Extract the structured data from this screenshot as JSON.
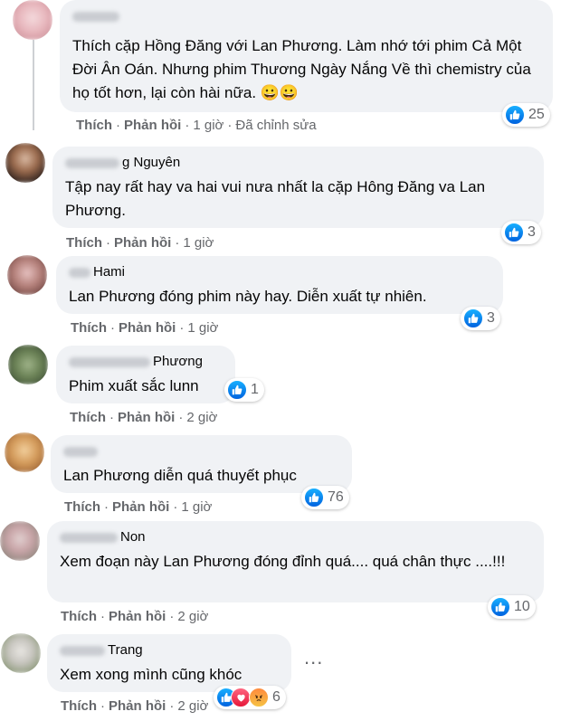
{
  "comments": [
    {
      "author_visible": "",
      "text": "Thích cặp Hồng Đăng với Lan Phương. Làm nhớ tới phim Cả Một Đời Ân Oán. Nhưng phim Thương Ngày Nắng Về thì chemistry của họ tốt hơn, lại còn hài nữa. 😀😀",
      "like": "Thích",
      "reply": "Phản hồi",
      "time": "1 giờ",
      "edited": "Đã chỉnh sửa",
      "reactions": "25"
    },
    {
      "author_visible": "g Nguyên",
      "text": "Tập nay rất hay va hai vui nưa nhất la cặp Hông Đăng va Lan Phương.",
      "like": "Thích",
      "reply": "Phản hồi",
      "time": "1 giờ",
      "reactions": "3"
    },
    {
      "author_visible": "Hami",
      "text": "Lan Phương đóng phim này hay. Diễn xuất tự nhiên.",
      "like": "Thích",
      "reply": "Phản hồi",
      "time": "1 giờ",
      "reactions": "3"
    },
    {
      "author_visible": "Phương",
      "text": "Phim xuất sắc lunn",
      "like": "Thích",
      "reply": "Phản hồi",
      "time": "2 giờ",
      "reactions": "1"
    },
    {
      "author_visible": "",
      "text": "Lan Phương diễn quá thuyết phục",
      "like": "Thích",
      "reply": "Phản hồi",
      "time": "1 giờ",
      "reactions": "76"
    },
    {
      "author_visible": "Non",
      "text": "Xem đoạn này Lan Phương đóng đỉnh quá.... quá chân thực ....!!!",
      "like": "Thích",
      "reply": "Phản hồi",
      "time": "2 giờ",
      "reactions": "10"
    },
    {
      "author_visible": "Trang",
      "text": "Xem xong mình cũng khóc",
      "like": "Thích",
      "reply": "Phản hồi",
      "time": "2 giờ",
      "reactions": "6"
    }
  ],
  "more_options": "...",
  "colors": {
    "bubble": "#f0f2f5",
    "meta": "#65676b",
    "like_blue": "#1877f2",
    "love_red": "#f33e58",
    "angry_orange": "#f7b125"
  }
}
